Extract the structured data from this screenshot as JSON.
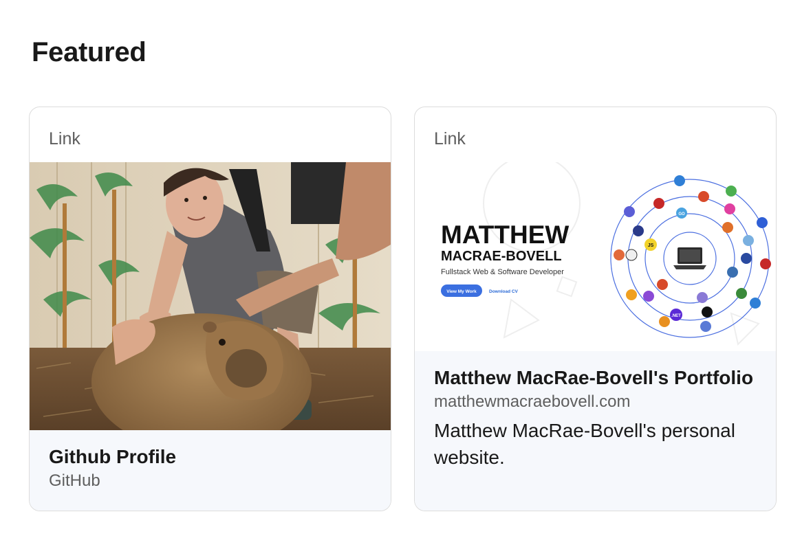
{
  "section": {
    "title": "Featured"
  },
  "cards": [
    {
      "kind": "Link",
      "title": "Github Profile",
      "subtitle": "GitHub",
      "image_description_icon": "photo-person-with-capybara"
    },
    {
      "kind": "Link",
      "title": "Matthew MacRae-Bovell's Portfolio",
      "subtitle": "matthewmacraebovell.com",
      "description": "Matthew MacRae-Bovell's personal website.",
      "thumbnail": {
        "name_line1": "MATTHEW",
        "name_line2": "MACRAE-BOVELL",
        "tagline": "Fullstack Web & Software Developer",
        "primary_button": "View My Work",
        "secondary_link": "Download CV",
        "badge_js": "JS",
        "badge_go": "GO",
        "badge_net": ".NET"
      }
    }
  ],
  "colors": {
    "accent_blue": "#3b6fe0",
    "link_blue": "#2b6ad6",
    "card_border": "#dcdcdc",
    "meta_background": "#f6f8fc"
  }
}
